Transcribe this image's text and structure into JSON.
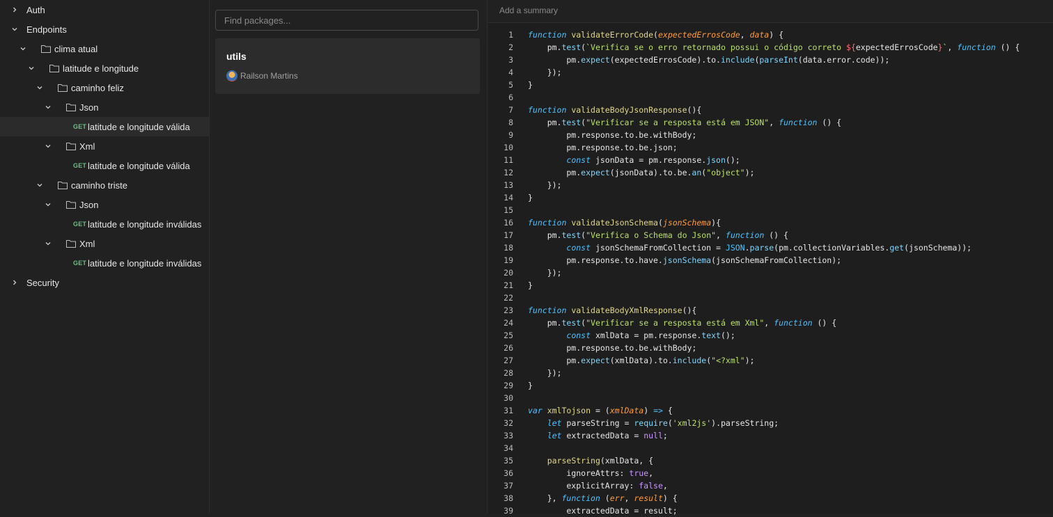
{
  "sidebar": {
    "items": [
      {
        "label": "Auth",
        "depth": 0,
        "type": "collection",
        "expanded": false
      },
      {
        "label": "Endpoints",
        "depth": 0,
        "type": "collection",
        "expanded": true
      },
      {
        "label": "clima atual",
        "depth": 1,
        "type": "folder",
        "expanded": true
      },
      {
        "label": "latitude e longitude",
        "depth": 2,
        "type": "folder",
        "expanded": true
      },
      {
        "label": "caminho feliz",
        "depth": 3,
        "type": "folder",
        "expanded": true
      },
      {
        "label": "Json",
        "depth": 4,
        "type": "folder",
        "expanded": true
      },
      {
        "label": "latitude e longitude válida",
        "depth": 5,
        "type": "request",
        "method": "GET",
        "selected": true
      },
      {
        "label": "Xml",
        "depth": 4,
        "type": "folder",
        "expanded": true
      },
      {
        "label": "latitude e longitude válida",
        "depth": 5,
        "type": "request",
        "method": "GET"
      },
      {
        "label": "caminho triste",
        "depth": 3,
        "type": "folder",
        "expanded": true
      },
      {
        "label": "Json",
        "depth": 4,
        "type": "folder",
        "expanded": true
      },
      {
        "label": "latitude e longitude inválidas",
        "depth": 5,
        "type": "request",
        "method": "GET"
      },
      {
        "label": "Xml",
        "depth": 4,
        "type": "folder",
        "expanded": true
      },
      {
        "label": "latitude e longitude inválidas",
        "depth": 5,
        "type": "request",
        "method": "GET"
      },
      {
        "label": "Security",
        "depth": 0,
        "type": "collection",
        "expanded": false
      }
    ]
  },
  "packages": {
    "search_placeholder": "Find packages...",
    "cards": [
      {
        "name": "utils",
        "author": "Railson Martins"
      }
    ]
  },
  "editor": {
    "summary_placeholder": "Add a summary",
    "lines": [
      [
        [
          "kw",
          "function"
        ],
        [
          "pl",
          " "
        ],
        [
          "fn",
          "validateErrorCode"
        ],
        [
          "pl",
          "("
        ],
        [
          "param",
          "expectedErrosCode"
        ],
        [
          "pl",
          ", "
        ],
        [
          "param",
          "data"
        ],
        [
          "pl",
          ") {"
        ]
      ],
      [
        [
          "pl",
          "    pm."
        ],
        [
          "call",
          "test"
        ],
        [
          "pl",
          "("
        ],
        [
          "str",
          "`Verifica se o erro retornado possui o código correto "
        ],
        [
          "interp",
          "${"
        ],
        [
          "pl",
          "expectedErrosCode"
        ],
        [
          "interp",
          "}"
        ],
        [
          "str",
          "`"
        ],
        [
          "pl",
          ", "
        ],
        [
          "kw",
          "function"
        ],
        [
          "pl",
          " () {"
        ]
      ],
      [
        [
          "pl",
          "        pm."
        ],
        [
          "call",
          "expect"
        ],
        [
          "pl",
          "(expectedErrosCode).to."
        ],
        [
          "call",
          "include"
        ],
        [
          "pl",
          "("
        ],
        [
          "call",
          "parseInt"
        ],
        [
          "pl",
          "(data.error.code));"
        ]
      ],
      [
        [
          "pl",
          "    });"
        ]
      ],
      [
        [
          "pl",
          "}"
        ]
      ],
      [],
      [
        [
          "kw",
          "function"
        ],
        [
          "pl",
          " "
        ],
        [
          "fn",
          "validateBodyJsonResponse"
        ],
        [
          "pl",
          "(){"
        ]
      ],
      [
        [
          "pl",
          "    pm."
        ],
        [
          "call",
          "test"
        ],
        [
          "pl",
          "("
        ],
        [
          "str",
          "\"Verificar se a resposta está em JSON\""
        ],
        [
          "pl",
          ", "
        ],
        [
          "kw",
          "function"
        ],
        [
          "pl",
          " () {"
        ]
      ],
      [
        [
          "pl",
          "        pm.response.to.be.withBody;"
        ]
      ],
      [
        [
          "pl",
          "        pm.response.to.be.json;"
        ]
      ],
      [
        [
          "pl",
          "        "
        ],
        [
          "kw",
          "const"
        ],
        [
          "pl",
          " jsonData = pm.response."
        ],
        [
          "call",
          "json"
        ],
        [
          "pl",
          "();"
        ]
      ],
      [
        [
          "pl",
          "        pm."
        ],
        [
          "call",
          "expect"
        ],
        [
          "pl",
          "(jsonData).to.be."
        ],
        [
          "call",
          "an"
        ],
        [
          "pl",
          "("
        ],
        [
          "str",
          "\"object\""
        ],
        [
          "pl",
          ");"
        ]
      ],
      [
        [
          "pl",
          "    });"
        ]
      ],
      [
        [
          "pl",
          "}"
        ]
      ],
      [],
      [
        [
          "kw",
          "function"
        ],
        [
          "pl",
          " "
        ],
        [
          "fn",
          "validateJsonSchema"
        ],
        [
          "pl",
          "("
        ],
        [
          "param",
          "jsonSchema"
        ],
        [
          "pl",
          "){"
        ]
      ],
      [
        [
          "pl",
          "    pm."
        ],
        [
          "call",
          "test"
        ],
        [
          "pl",
          "("
        ],
        [
          "str",
          "\"Verifica o Schema do Json\""
        ],
        [
          "pl",
          ", "
        ],
        [
          "kw",
          "function"
        ],
        [
          "pl",
          " () {"
        ]
      ],
      [
        [
          "pl",
          "        "
        ],
        [
          "kw",
          "const"
        ],
        [
          "pl",
          " jsonSchemaFromCollection = "
        ],
        [
          "cls",
          "JSON"
        ],
        [
          "pl",
          "."
        ],
        [
          "call",
          "parse"
        ],
        [
          "pl",
          "(pm.collectionVariables."
        ],
        [
          "call",
          "get"
        ],
        [
          "pl",
          "(jsonSchema));"
        ]
      ],
      [
        [
          "pl",
          "        pm.response.to.have."
        ],
        [
          "call",
          "jsonSchema"
        ],
        [
          "pl",
          "(jsonSchemaFromCollection);"
        ]
      ],
      [
        [
          "pl",
          "    });"
        ]
      ],
      [
        [
          "pl",
          "}"
        ]
      ],
      [],
      [
        [
          "kw",
          "function"
        ],
        [
          "pl",
          " "
        ],
        [
          "fn",
          "validateBodyXmlResponse"
        ],
        [
          "pl",
          "(){"
        ]
      ],
      [
        [
          "pl",
          "    pm."
        ],
        [
          "call",
          "test"
        ],
        [
          "pl",
          "("
        ],
        [
          "str",
          "\"Verificar se a resposta está em Xml\""
        ],
        [
          "pl",
          ", "
        ],
        [
          "kw",
          "function"
        ],
        [
          "pl",
          " () {"
        ]
      ],
      [
        [
          "pl",
          "        "
        ],
        [
          "kw",
          "const"
        ],
        [
          "pl",
          " xmlData = pm.response."
        ],
        [
          "call",
          "text"
        ],
        [
          "pl",
          "();"
        ]
      ],
      [
        [
          "pl",
          "        pm.response.to.be.withBody;"
        ]
      ],
      [
        [
          "pl",
          "        pm."
        ],
        [
          "call",
          "expect"
        ],
        [
          "pl",
          "(xmlData).to."
        ],
        [
          "call",
          "include"
        ],
        [
          "pl",
          "("
        ],
        [
          "str",
          "\"<?xml\""
        ],
        [
          "pl",
          ");"
        ]
      ],
      [
        [
          "pl",
          "    });"
        ]
      ],
      [
        [
          "pl",
          "}"
        ]
      ],
      [],
      [
        [
          "kw",
          "var"
        ],
        [
          "pl",
          " "
        ],
        [
          "fn",
          "xmlTojson"
        ],
        [
          "pl",
          " = ("
        ],
        [
          "param",
          "xmlData"
        ],
        [
          "pl",
          ") "
        ],
        [
          "kw",
          "=>"
        ],
        [
          "pl",
          " {"
        ]
      ],
      [
        [
          "pl",
          "    "
        ],
        [
          "kw",
          "let"
        ],
        [
          "pl",
          " parseString = "
        ],
        [
          "call",
          "require"
        ],
        [
          "pl",
          "("
        ],
        [
          "str",
          "'xml2js'"
        ],
        [
          "pl",
          ").parseString;"
        ]
      ],
      [
        [
          "pl",
          "    "
        ],
        [
          "kw",
          "let"
        ],
        [
          "pl",
          " extractedData = "
        ],
        [
          "lit",
          "null"
        ],
        [
          "pl",
          ";"
        ]
      ],
      [],
      [
        [
          "pl",
          "    "
        ],
        [
          "fn",
          "parseString"
        ],
        [
          "pl",
          "(xmlData, {"
        ]
      ],
      [
        [
          "pl",
          "        ignoreAttrs: "
        ],
        [
          "lit",
          "true"
        ],
        [
          "pl",
          ","
        ]
      ],
      [
        [
          "pl",
          "        explicitArray: "
        ],
        [
          "lit",
          "false"
        ],
        [
          "pl",
          ","
        ]
      ],
      [
        [
          "pl",
          "    }, "
        ],
        [
          "kw",
          "function"
        ],
        [
          "pl",
          " ("
        ],
        [
          "param",
          "err"
        ],
        [
          "pl",
          ", "
        ],
        [
          "param",
          "result"
        ],
        [
          "pl",
          ") {"
        ]
      ],
      [
        [
          "pl",
          "        extractedData = result;"
        ]
      ]
    ]
  }
}
